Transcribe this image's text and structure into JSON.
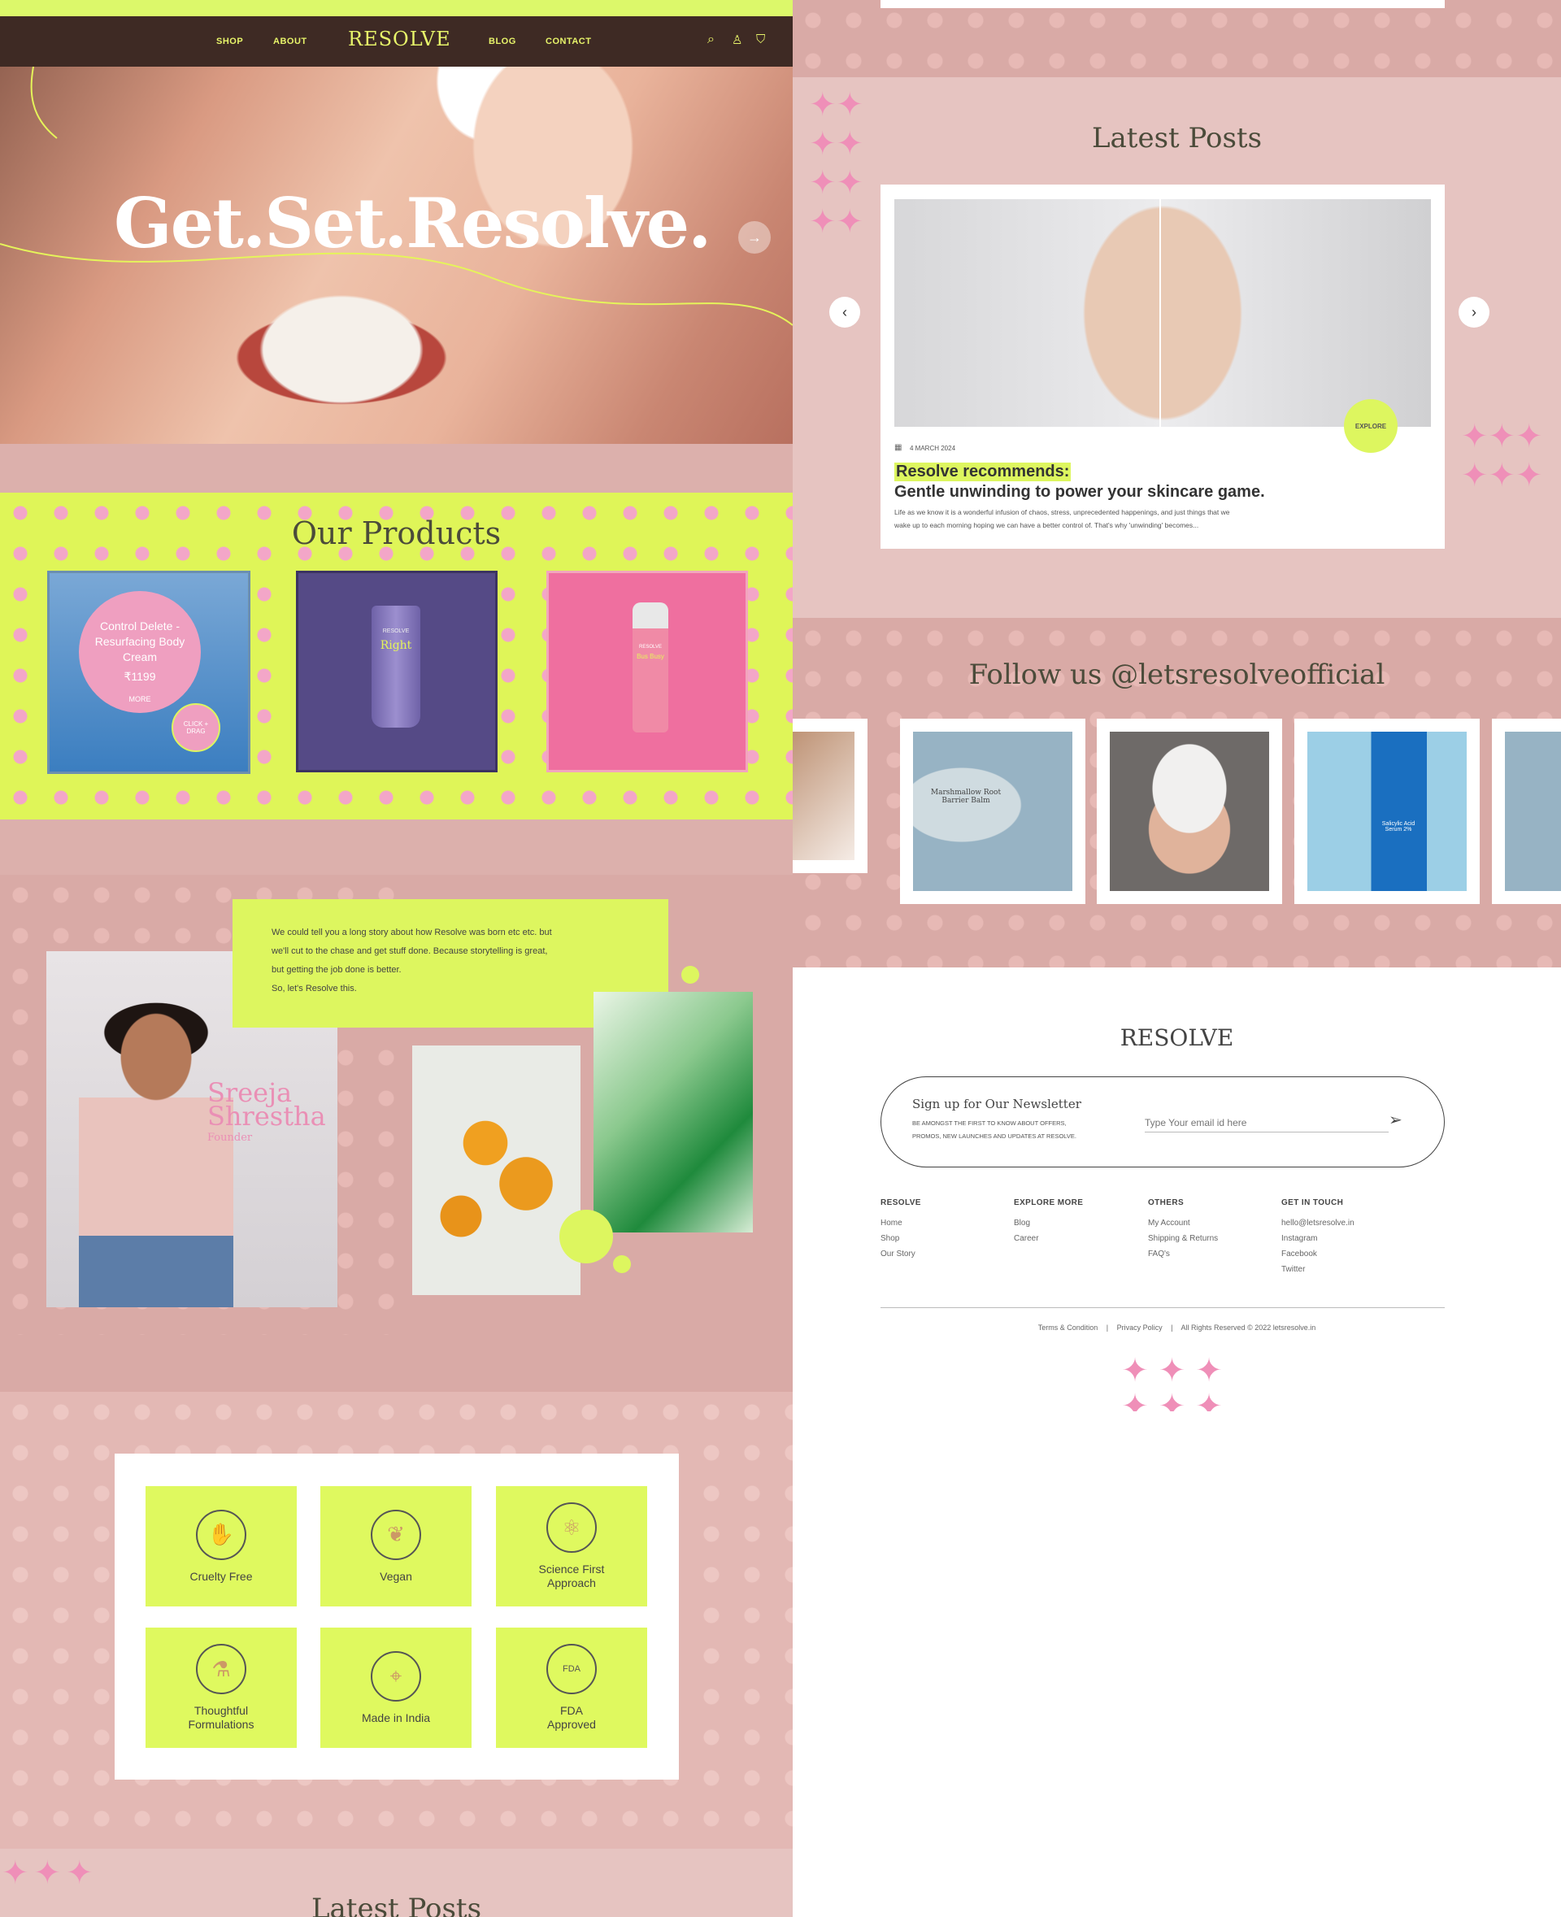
{
  "nav": {
    "links_left": [
      "SHOP",
      "ABOUT"
    ],
    "logo": "RESOLVE",
    "links_right": [
      "BLOG",
      "CONTACT"
    ],
    "icons": [
      "search-icon",
      "user-icon",
      "bag-icon"
    ]
  },
  "hero": {
    "headline": "Get.Set.Resolve."
  },
  "products": {
    "title": "Our Products",
    "featured": {
      "name": "Control Delete - Resurfacing Body Cream",
      "price": "₹1199",
      "more": "MORE",
      "drag": "CLICK + DRAG"
    },
    "items": [
      {
        "label": "RESOLVE",
        "name": "Right"
      },
      {
        "label": "RESOLVE",
        "name": "Bus Busy"
      }
    ]
  },
  "about": {
    "story": [
      "We could tell you a long story about how Resolve was born etc etc. but",
      "we'll cut to the chase and get stuff done. Because storytelling is great,",
      "but getting the job done is better.",
      "So, let's Resolve this."
    ],
    "founder_name_1": "Sreeja",
    "founder_name_2": "Shrestha",
    "founder_role": "Founder"
  },
  "features": [
    {
      "icon": "cruelty-free-icon",
      "label_1": "Cruelty Free",
      "label_2": ""
    },
    {
      "icon": "vegan-leaf-icon",
      "label_1": "Vegan",
      "label_2": ""
    },
    {
      "icon": "science-atom-icon",
      "label_1": "Science First",
      "label_2": "Approach"
    },
    {
      "icon": "flask-icon",
      "label_1": "Thoughtful",
      "label_2": "Formulations"
    },
    {
      "icon": "india-map-icon",
      "label_1": "Made in India",
      "label_2": ""
    },
    {
      "icon": "fda-badge-icon",
      "label_1": "FDA",
      "label_2": "Approved"
    }
  ],
  "latest_posts_left": {
    "title": "Latest Posts"
  },
  "latest_posts": {
    "title": "Latest Posts",
    "date": "4 MARCH 2024",
    "explore": "EXPLORE",
    "highlight": "Resolve recommends:",
    "headline": "Gentle unwinding to power your skincare game.",
    "excerpt_1": "Life as we know it is a wonderful infusion of chaos, stress, unprecedented happenings, and just things that we",
    "excerpt_2": "wake up to each morning hoping we can have a better control of. That's why 'unwinding' becomes..."
  },
  "follow": {
    "title": "Follow us @letsresolveofficial",
    "jar_label": "Marshmallow Root Barrier Balm",
    "serum_label": "Salicylic Acid Serum 2%"
  },
  "footer": {
    "logo": "RESOLVE",
    "newsletter_title": "Sign up for Our Newsletter",
    "newsletter_desc_1": "BE AMONGST THE FIRST TO KNOW ABOUT OFFERS,",
    "newsletter_desc_2": "PROMOS, NEW LAUNCHES AND UPDATES AT RESOLVE.",
    "email_placeholder": "Type Your email id here",
    "columns": [
      {
        "title": "RESOLVE",
        "links": [
          "Home",
          "Shop",
          "Our Story"
        ]
      },
      {
        "title": "EXPLORE MORE",
        "links": [
          "Blog",
          "Career"
        ]
      },
      {
        "title": "OTHERS",
        "links": [
          "My Account",
          "Shipping & Returns",
          "FAQ's"
        ]
      },
      {
        "title": "GET IN TOUCH",
        "links": [
          "hello@letsresolve.in",
          "Instagram",
          "Facebook",
          "Twitter"
        ]
      }
    ],
    "legal": [
      "Terms & Condition",
      "|",
      "Privacy Policy",
      "|",
      "All Rights Reserved © 2022 letsresolve.in"
    ]
  },
  "colors": {
    "lime": "#ddf65f",
    "pink_bg": "#d9aaa6",
    "star_pink": "#ef8fb8",
    "nav_bg": "#3e2a24"
  }
}
